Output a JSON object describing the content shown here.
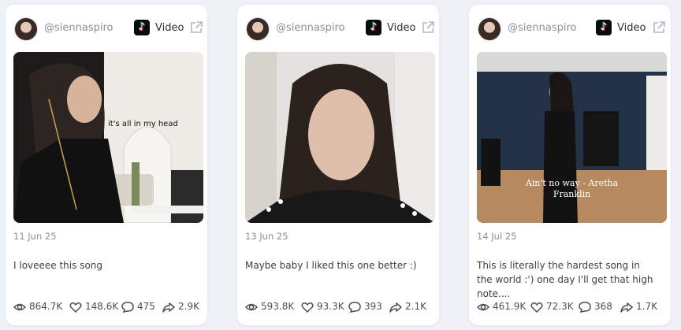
{
  "cards": [
    {
      "handle": "@siennaspiro",
      "platform_label": "Video",
      "overlay_text": "it's all in my head",
      "date": "11 Jun 25",
      "caption": "I loveeee this song",
      "views": "864.7K",
      "likes": "148.6K",
      "comments": "475",
      "shares": "2.9K"
    },
    {
      "handle": "@siennaspiro",
      "platform_label": "Video",
      "overlay_text": "",
      "date": "13 Jun 25",
      "caption": "Maybe baby I liked this one better :)",
      "views": "593.8K",
      "likes": "93.3K",
      "comments": "393",
      "shares": "2.1K"
    },
    {
      "handle": "@siennaspiro",
      "platform_label": "Video",
      "overlay_text": "Ain't no way - Aretha Franklin",
      "date": "14 Jul 25",
      "caption": "This is literally the hardest song in the world :') one day I'll get that high note....",
      "views": "461.9K",
      "likes": "72.3K",
      "comments": "368",
      "shares": "1.7K"
    }
  ],
  "icons": {
    "platform": "tiktok-icon",
    "external": "external-link-icon",
    "views": "eye-icon",
    "likes": "heart-icon",
    "comments": "comment-icon",
    "shares": "share-icon"
  },
  "colors": {
    "background": "#eef1f6",
    "card": "#ffffff",
    "muted_text": "#8a8f9a"
  }
}
